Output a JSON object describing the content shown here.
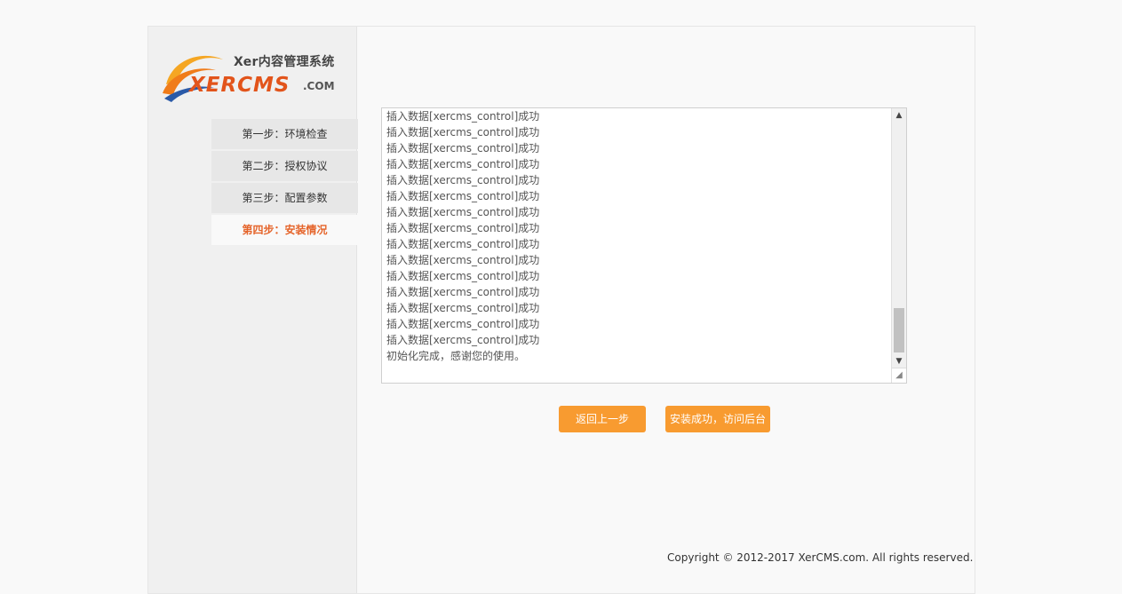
{
  "logo": {
    "tagline": "Xer内容管理系统",
    "brand": "XERCMS",
    "domain": ".COM"
  },
  "steps": [
    {
      "label": "第一步：环境检查",
      "active": false
    },
    {
      "label": "第二步：授权协议",
      "active": false
    },
    {
      "label": "第三步：配置参数",
      "active": false
    },
    {
      "label": "第四步：安装情况",
      "active": true
    }
  ],
  "log": {
    "lines": [
      "插入数据[xercms_control]成功",
      "插入数据[xercms_control]成功",
      "插入数据[xercms_control]成功",
      "插入数据[xercms_control]成功",
      "插入数据[xercms_control]成功",
      "插入数据[xercms_control]成功",
      "插入数据[xercms_control]成功",
      "插入数据[xercms_control]成功",
      "插入数据[xercms_control]成功",
      "插入数据[xercms_control]成功",
      "插入数据[xercms_control]成功",
      "插入数据[xercms_control]成功",
      "插入数据[xercms_control]成功",
      "插入数据[xercms_control]成功",
      "插入数据[xercms_control]成功",
      "初始化完成，感谢您的使用。"
    ]
  },
  "buttons": {
    "prev": "返回上一步",
    "admin": "安装成功，访问后台"
  },
  "footer": {
    "copyright": "Copyright © 2012-2017 XerCMS.com. All rights reserved."
  },
  "colors": {
    "accent": "#f89b30",
    "active_step": "#e5642a",
    "brand": "#e2541b"
  }
}
